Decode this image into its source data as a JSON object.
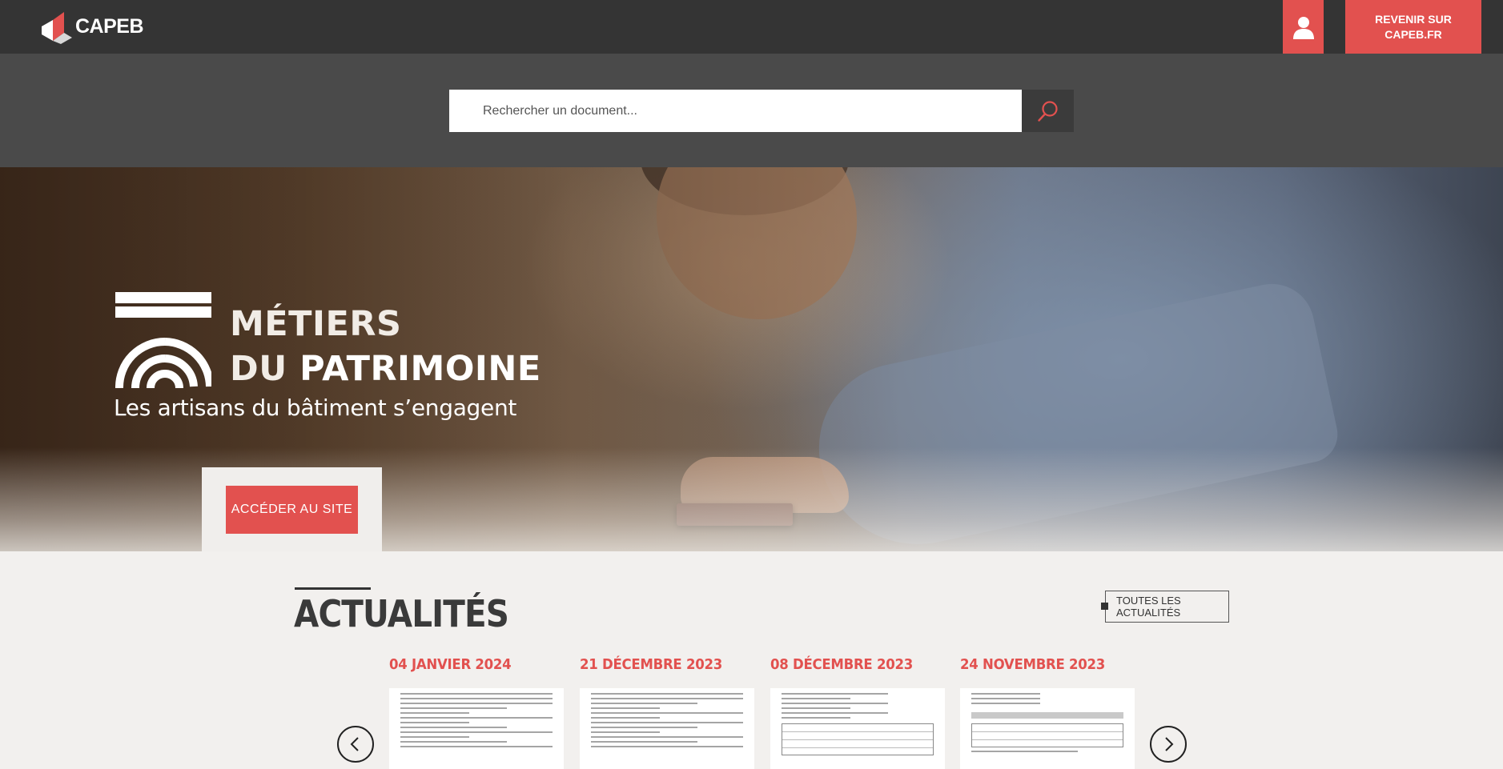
{
  "header": {
    "logo_text": "CAPEB",
    "user_icon": "user-icon",
    "back_label_line1": "REVENIR SUR",
    "back_label_line2": "CAPEB.FR"
  },
  "search": {
    "placeholder": "Rechercher un document...",
    "value": "",
    "icon": "search-icon"
  },
  "hero": {
    "title_line1": "MÉTIERS",
    "title_line2_prefix": "DU",
    "title_line2_strong": "PATRIMOINE",
    "subtitle": "Les artisans du bâtiment s’engagent",
    "cta_label": "ACCÉDER AU SITE"
  },
  "news": {
    "heading": "ACTUALITÉS",
    "all_news_label": "TOUTES LES ACTUALITÉS",
    "prev_icon": "chevron-left-icon",
    "next_icon": "chevron-right-icon",
    "items": [
      {
        "date": "04 JANVIER 2024"
      },
      {
        "date": "21 DÉCEMBRE 2023"
      },
      {
        "date": "08 DÉCEMBRE 2023"
      },
      {
        "date": "24 NOVEMBRE 2023"
      }
    ]
  },
  "colors": {
    "accent": "#e2514f",
    "topbar": "#343434",
    "search_band": "#4a4a4a",
    "background": "#f2f0ee"
  }
}
